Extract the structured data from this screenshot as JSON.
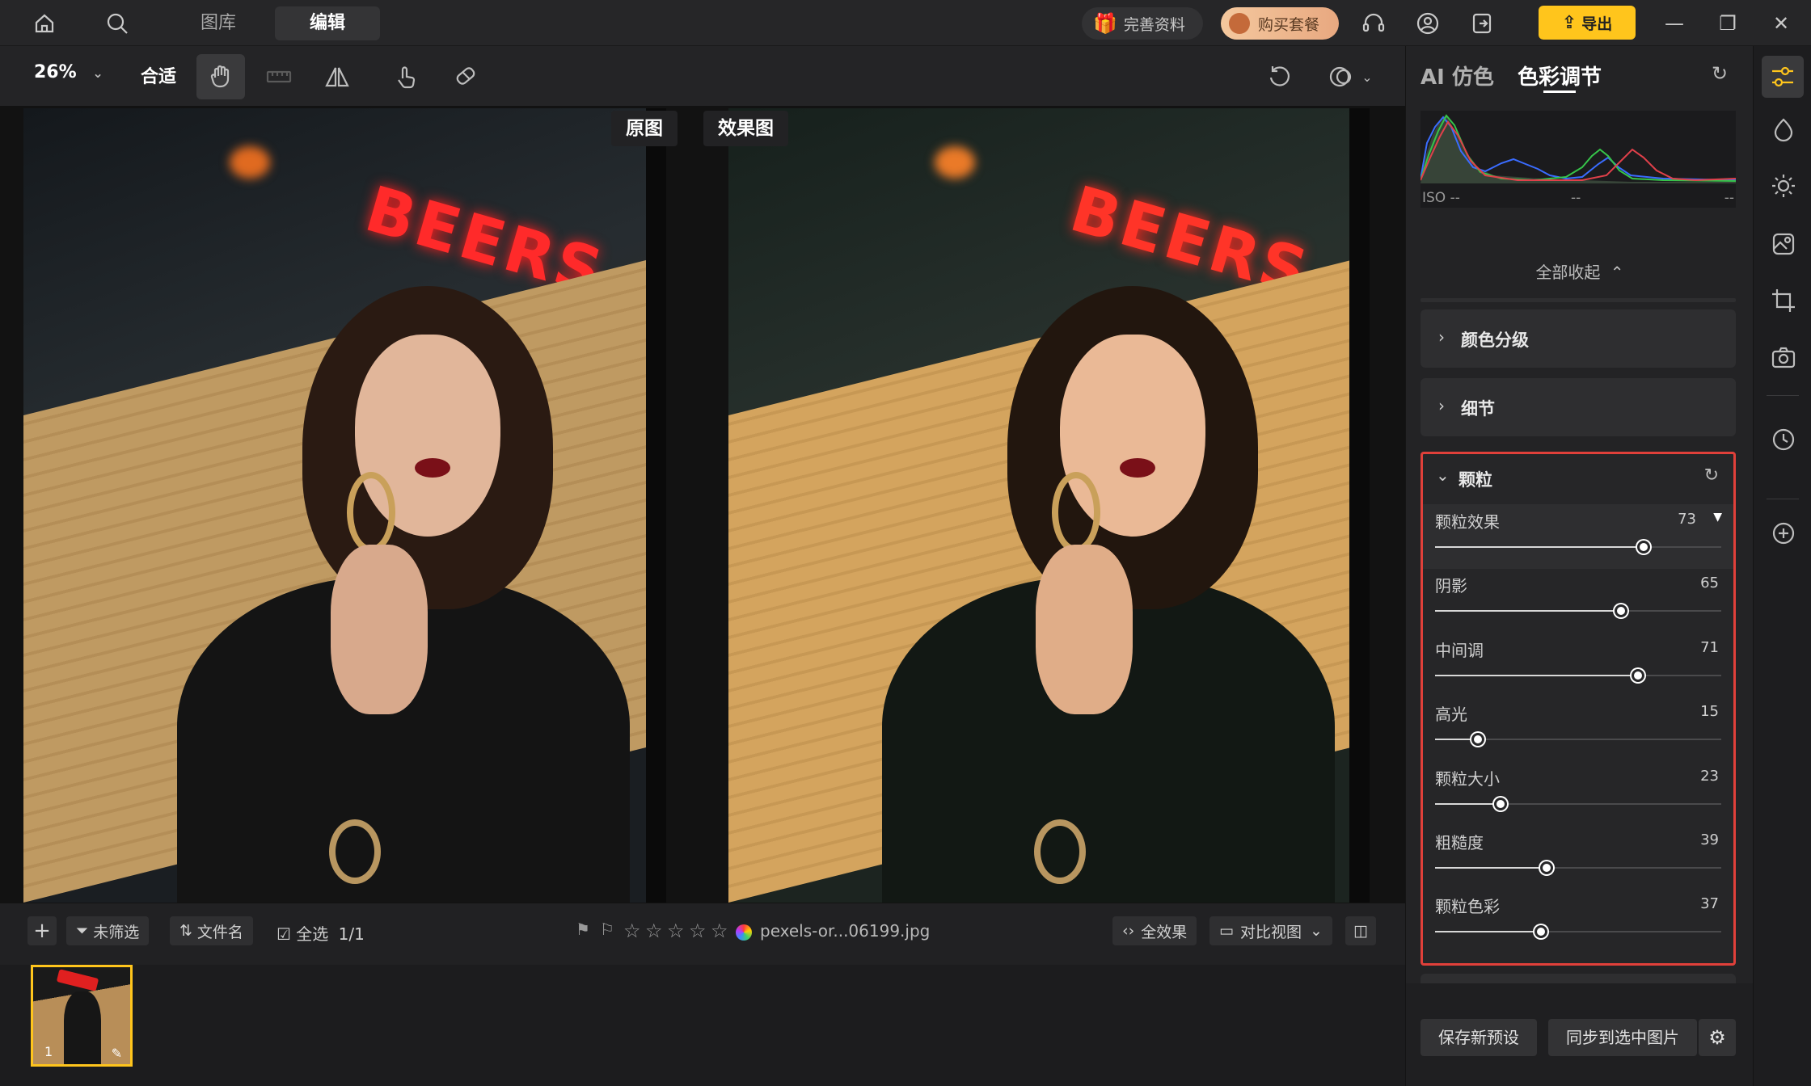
{
  "topbar": {
    "tabs": [
      {
        "label": "图库"
      },
      {
        "label": "编辑"
      }
    ],
    "active_tab": "编辑",
    "profile_label": "完善资料",
    "buy_label": "购买套餐",
    "export_label": "导出"
  },
  "toolbar": {
    "zoom": "26%",
    "fit_label": "合适"
  },
  "canvas": {
    "original_label": "原图",
    "effect_label": "效果图",
    "neon_text": "BEERS"
  },
  "filmbar": {
    "unfiltered_label": "未筛选",
    "filename_sort_label": "文件名",
    "select_all_label": "全选",
    "select_count": "1/1",
    "filename": "pexels-or...06199.jpg",
    "rating": 0,
    "full_effect_label": "全效果",
    "compare_view_label": "对比视图",
    "thumb_index": "1"
  },
  "panel": {
    "tab_ai": "AI 仿色",
    "tab_color": "色彩调节",
    "histogram": {
      "iso": "ISO --",
      "mid": "--",
      "right": "--"
    },
    "collapse_all_label": "全部收起",
    "sections": [
      {
        "title": "颜色分级"
      },
      {
        "title": "细节"
      }
    ],
    "grain": {
      "title": "颗粒",
      "sliders": [
        {
          "label": "颗粒效果",
          "value": 73,
          "fill": 0.73
        },
        {
          "label": "阴影",
          "value": 65,
          "fill": 0.65
        },
        {
          "label": "中间调",
          "value": 71,
          "fill": 0.71
        },
        {
          "label": "高光",
          "value": 15,
          "fill": 0.15
        },
        {
          "label": "颗粒大小",
          "value": 23,
          "fill": 0.23
        },
        {
          "label": "粗糙度",
          "value": 39,
          "fill": 0.39
        },
        {
          "label": "颗粒色彩",
          "value": 37,
          "fill": 0.37
        }
      ]
    },
    "save_preset_label": "保存新预设",
    "sync_label": "同步到选中图片"
  },
  "colors": {
    "accent": "#ffc51c",
    "highlight_border": "#e0403a"
  }
}
